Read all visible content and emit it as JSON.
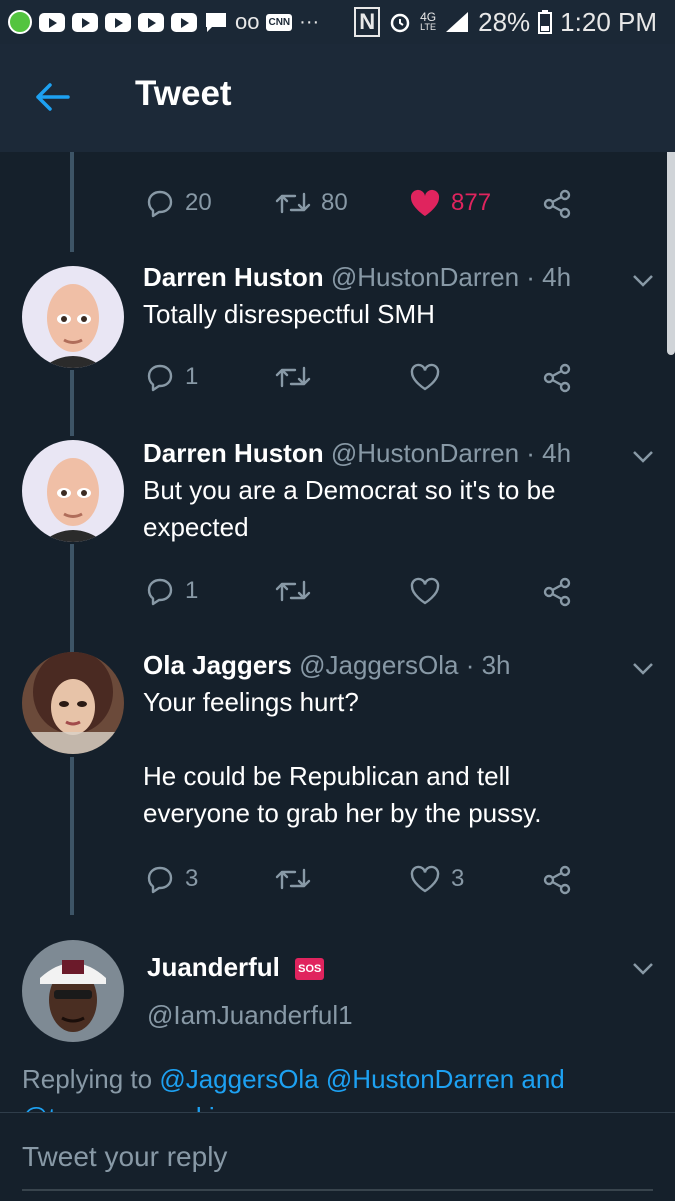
{
  "status_bar": {
    "battery": "28%",
    "time": "1:20 PM",
    "network": "4G",
    "network_sub": "LTE",
    "cnn": "CNN",
    "voicemail": "oo",
    "more": "···",
    "nfc": "N"
  },
  "header": {
    "title": "Tweet"
  },
  "parent_tweet": {
    "replies": "20",
    "retweets": "80",
    "likes": "877",
    "like_color": "#e0245e"
  },
  "tweets": [
    {
      "name": "Darren Huston",
      "handle": "@HustonDarren",
      "time": "· 4h",
      "text": "Totally disrespectful SMH",
      "replies": "1",
      "retweets": "",
      "likes": ""
    },
    {
      "name": "Darren Huston",
      "handle": "@HustonDarren",
      "time": "· 4h",
      "text": "But you are a Democrat so it's to be expected",
      "replies": "1",
      "retweets": "",
      "likes": ""
    },
    {
      "name": "Ola Jaggers",
      "handle": "@JaggersOla",
      "time": "· 3h",
      "text": "Your feelings hurt?\n\nHe could be Republican and tell everyone to grab her by the pussy.",
      "replies": "3",
      "retweets": "",
      "likes": "3"
    }
  ],
  "main_tweet": {
    "name": "Juanderful",
    "badge": "SOS",
    "handle": "@IamJuanderful1",
    "replying_prefix": "Replying to",
    "replying_1": "@JaggersOla",
    "replying_2": "@HustonDarren",
    "replying_and": "and",
    "replying_3": "@tonyposnanski"
  },
  "reply_box": {
    "placeholder": "Tweet your reply"
  },
  "colors": {
    "background": "#15202b",
    "accent": "#1da1f2",
    "muted": "#8899a6",
    "like": "#e0245e"
  }
}
